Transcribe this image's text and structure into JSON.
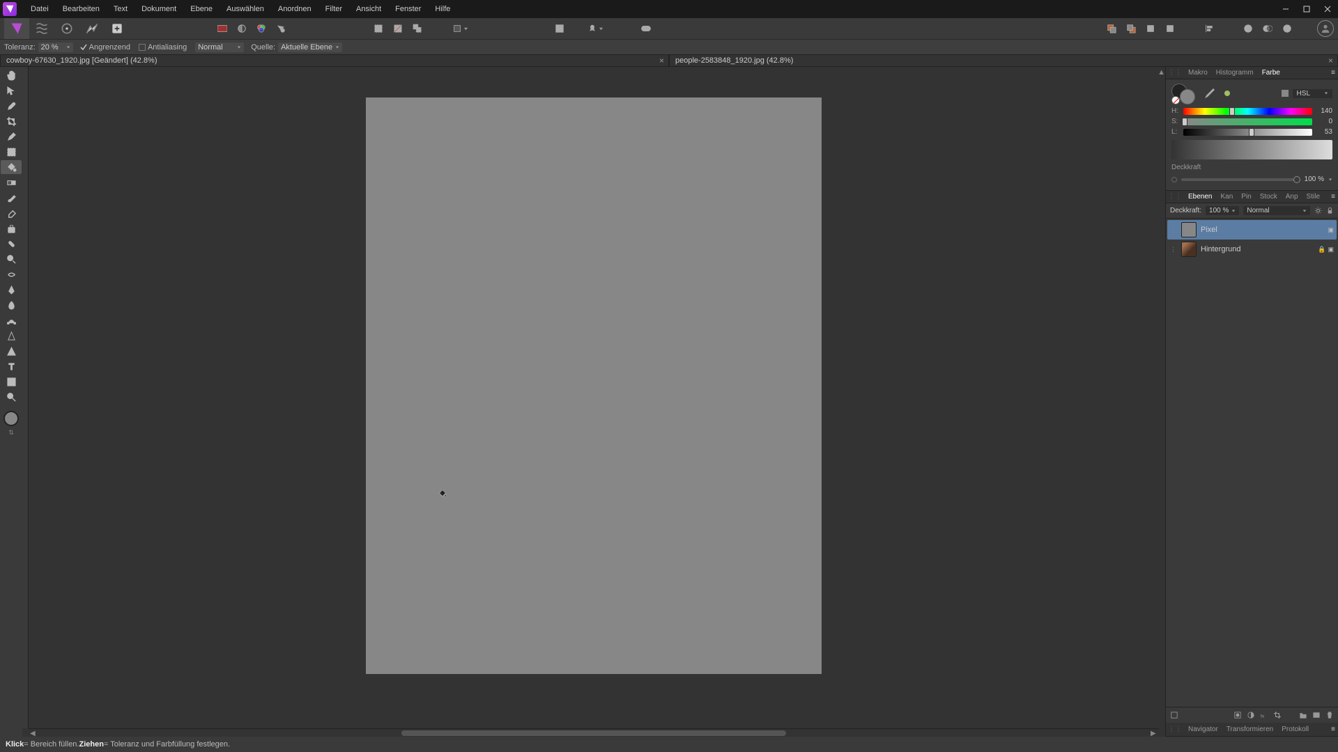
{
  "menu": [
    "Datei",
    "Bearbeiten",
    "Text",
    "Dokument",
    "Ebene",
    "Auswählen",
    "Anordnen",
    "Filter",
    "Ansicht",
    "Fenster",
    "Hilfe"
  ],
  "context": {
    "tolerance_label": "Toleranz:",
    "tolerance_value": "20 %",
    "angrenzend": "Angrenzend",
    "antialiasing": "Antialiasing",
    "blend_mode": "Normal",
    "source_label": "Quelle:",
    "source_value": "Aktuelle Ebene"
  },
  "tabs": [
    {
      "title": "cowboy-67630_1920.jpg [Geändert] (42.8%)",
      "active": true
    },
    {
      "title": "people-2583848_1920.jpg (42.8%)",
      "active": false
    }
  ],
  "right_top_tabs": [
    "Makro",
    "Histogramm",
    "Farbe"
  ],
  "right_top_active": "Farbe",
  "color": {
    "mode": "HSL",
    "h": {
      "label": "H:",
      "value": "140",
      "pos": 38
    },
    "s": {
      "label": "S:",
      "value": "0",
      "pos": 0
    },
    "l": {
      "label": "L:",
      "value": "53",
      "pos": 53
    }
  },
  "opacity": {
    "label": "Deckkraft",
    "value": "100 %"
  },
  "layers_tabs": [
    "Ebenen",
    "Kan",
    "Pin",
    "Stock",
    "Anp",
    "Stile"
  ],
  "layers_tabs_active": "Ebenen",
  "layers_header": {
    "opacity_label": "Deckkraft:",
    "opacity_value": "100 %",
    "blend": "Normal"
  },
  "layers": [
    {
      "name": "Pixel",
      "selected": true,
      "bg": false
    },
    {
      "name": "Hintergrund",
      "selected": false,
      "bg": true
    }
  ],
  "bottom_tabs": [
    "Navigator",
    "Transformieren",
    "Protokoll"
  ],
  "status": {
    "click": "Klick",
    "click_txt": " = Bereich füllen. ",
    "drag": "Ziehen",
    "drag_txt": " = Toleranz und Farbfüllung festlegen."
  }
}
